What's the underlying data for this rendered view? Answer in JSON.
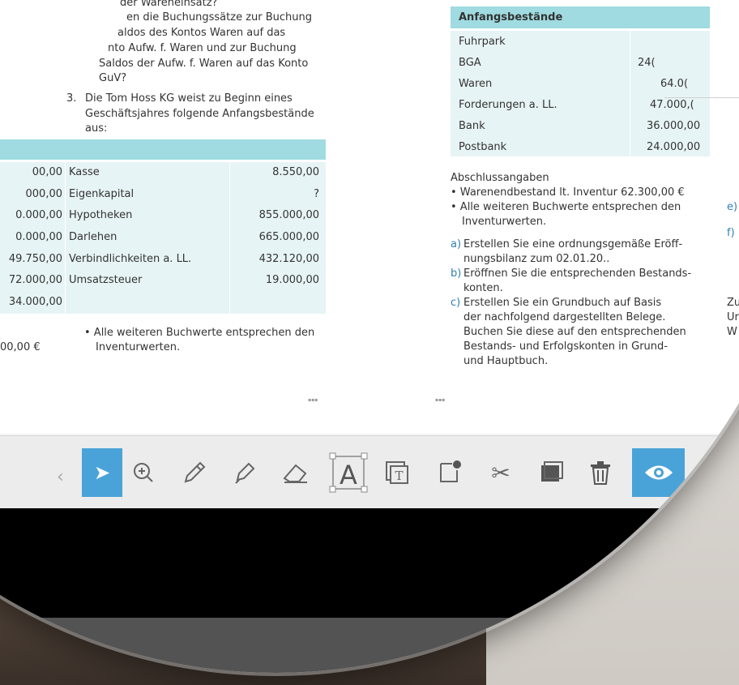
{
  "left_page": {
    "question_lines": [
      "der Wareneinsatz?",
      "en die Buchungssätze zur Buchung",
      "aldos des Kontos Waren auf das",
      "nto Aufw. f. Waren und zur Buchung",
      "Saldos der Aufw. f. Waren auf das Konto",
      "GuV?"
    ],
    "item_number": "3.",
    "item_text_lines": [
      "Die Tom Hoss KG weist zu Beginn eines",
      "Geschäftsjahres folgende Anfangsbestände",
      "aus:"
    ],
    "table_rows": [
      {
        "left_value": "00,00",
        "label": "Kasse",
        "value": "8.550,00"
      },
      {
        "left_value": "000,00",
        "label": "Eigenkapital",
        "value": "?"
      },
      {
        "left_value": "0.000,00",
        "label": "Hypotheken",
        "value": "855.000,00"
      },
      {
        "left_value": "0.000,00",
        "label": "Darlehen",
        "value": "665.000,00"
      },
      {
        "left_value": "49.750,00",
        "label": "Verbindlichkeiten a. LL.",
        "value": "432.120,00"
      },
      {
        "left_value": "72.000,00",
        "label": "Umsatzsteuer",
        "value": "19.000,00"
      },
      {
        "left_value": "34.000,00",
        "label": "",
        "value": ""
      }
    ],
    "bottom_left_value": "00,00 €",
    "bottom_bullet_lines": [
      "• Alle weiteren Buchwerte entsprechen den",
      "Inventurwerten."
    ]
  },
  "right_page": {
    "table_title": "Anfangsbestände",
    "table_rows": [
      {
        "label": "Fuhrpark",
        "value": ""
      },
      {
        "label": "BGA",
        "value": "24("
      },
      {
        "label": "Waren",
        "value": "64.0("
      },
      {
        "label": "Forderungen a. LL.",
        "value": "47.000,("
      },
      {
        "label": "Bank",
        "value": "36.000,00"
      },
      {
        "label": "Postbank",
        "value": "24.000,00"
      }
    ],
    "closing_title": "Abschlussangaben",
    "closing_bullets": [
      "• Warenendbestand lt. Inventur 62.300,00 €",
      "• Alle weiteren Buchwerte entsprechen den",
      "Inventurwerten."
    ],
    "tasks": [
      {
        "letter": "a)",
        "lines": [
          "Erstellen Sie eine ordnungsgemäße Eröff-",
          "nungsbilanz zum 02.01.20.."
        ]
      },
      {
        "letter": "b)",
        "lines": [
          "Eröffnen Sie die entsprechenden Bestands-",
          "konten."
        ]
      },
      {
        "letter": "c)",
        "lines": [
          "Erstellen Sie ein Grundbuch auf Basis",
          "der nachfolgend dargestellten Belege.",
          "Buchen Sie diese auf den entsprechenden",
          "Bestands- und Erfolgskonten in Grund-",
          "und Hauptbuch."
        ]
      }
    ],
    "edge_letters": [
      "e)",
      "f)"
    ],
    "edge_lines": [
      "Zu",
      "Ur",
      "W"
    ]
  },
  "toolbar": {
    "tools": [
      {
        "name": "select-tool",
        "glyph": "➤",
        "active": true
      },
      {
        "name": "zoom-tool",
        "glyph": "⊕",
        "active": false
      },
      {
        "name": "pencil-tool",
        "glyph": "✎",
        "active": false
      },
      {
        "name": "highlighter-tool",
        "glyph": "✐",
        "active": false
      },
      {
        "name": "eraser-tool",
        "glyph": "⌫",
        "active": false
      },
      {
        "name": "text-box-tool",
        "glyph": "A",
        "active": false
      },
      {
        "name": "text-field-tool",
        "glyph": "T",
        "active": false
      },
      {
        "name": "note-tool",
        "glyph": "▱",
        "active": false
      },
      {
        "name": "cut-tool",
        "glyph": "✂",
        "active": false
      },
      {
        "name": "layer-tool",
        "glyph": "▣",
        "active": false
      },
      {
        "name": "delete-tool",
        "glyph": "🗑",
        "active": false
      },
      {
        "name": "visibility-tool",
        "glyph": "◉",
        "active": true
      }
    ]
  },
  "colors": {
    "accent_blue": "#4aa3d8",
    "table_header_teal": "#9fdbe0",
    "table_cell_light": "#e7f4f5"
  }
}
